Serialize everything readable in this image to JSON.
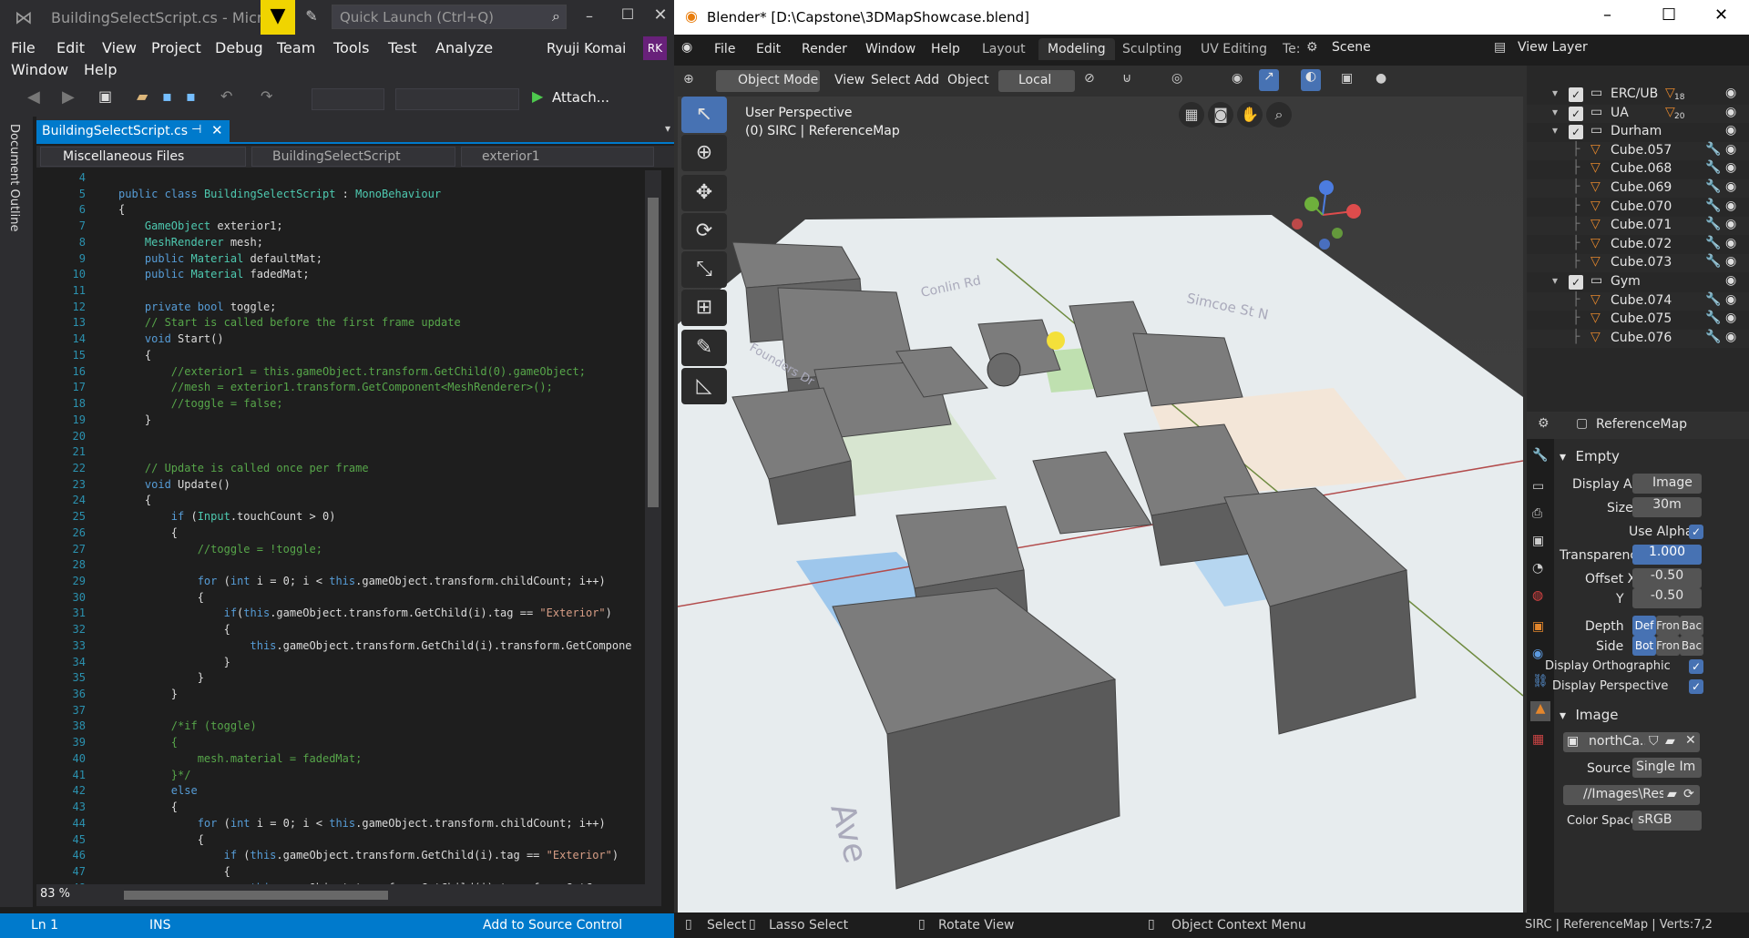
{
  "vs": {
    "title": "BuildingSelectScript.cs - Micros...",
    "quick_launch": "Quick Launch (Ctrl+Q)",
    "menu": [
      "File",
      "Edit",
      "View",
      "Project",
      "Debug",
      "Team",
      "Tools",
      "Test",
      "Analyze",
      "Window",
      "Help"
    ],
    "user": "Ryuji Komai",
    "user_initials": "RK",
    "attach": "Attach...",
    "doc_outline": "Document Outline",
    "tab": "BuildingSelectScript.cs",
    "nav": {
      "project": "Miscellaneous Files",
      "class": "BuildingSelectScript",
      "member": "exterior1"
    },
    "zoom": "83 %",
    "status": {
      "ln": "Ln 1",
      "ins": "INS",
      "source": "Add to Source Control"
    },
    "code": [
      {
        "n": "4",
        "h": ""
      },
      {
        "n": "5",
        "h": "<span class='kw'>public class</span> <span class='ty'>BuildingSelectScript</span> : <span class='ty'>MonoBehaviour</span>"
      },
      {
        "n": "6",
        "h": "{"
      },
      {
        "n": "7",
        "h": "    <span class='ty'>GameObject</span> exterior1;"
      },
      {
        "n": "8",
        "h": "    <span class='ty'>MeshRenderer</span> mesh;"
      },
      {
        "n": "9",
        "h": "    <span class='kw'>public</span> <span class='ty'>Material</span> defaultMat;"
      },
      {
        "n": "10",
        "h": "    <span class='kw'>public</span> <span class='ty'>Material</span> fadedMat;"
      },
      {
        "n": "11",
        "h": ""
      },
      {
        "n": "12",
        "h": "    <span class='kw'>private bool</span> toggle;"
      },
      {
        "n": "13",
        "h": "    <span class='cm'>// Start is called before the first frame update</span>"
      },
      {
        "n": "14",
        "h": "    <span class='kw'>void</span> Start()"
      },
      {
        "n": "15",
        "h": "    {"
      },
      {
        "n": "16",
        "h": "        <span class='cm'>//exterior1 = this.gameObject.transform.GetChild(0).gameObject;</span>"
      },
      {
        "n": "17",
        "h": "        <span class='cm'>//mesh = exterior1.transform.GetComponent&lt;MeshRenderer&gt;();</span>"
      },
      {
        "n": "18",
        "h": "        <span class='cm'>//toggle = false;</span>"
      },
      {
        "n": "19",
        "h": "    }"
      },
      {
        "n": "20",
        "h": ""
      },
      {
        "n": "21",
        "h": ""
      },
      {
        "n": "22",
        "h": "    <span class='cm'>// Update is called once per frame</span>"
      },
      {
        "n": "23",
        "h": "    <span class='kw'>void</span> Update()"
      },
      {
        "n": "24",
        "h": "    {"
      },
      {
        "n": "25",
        "h": "        <span class='kw'>if</span> (<span class='ty'>Input</span>.touchCount &gt; 0)"
      },
      {
        "n": "26",
        "h": "        {"
      },
      {
        "n": "27",
        "h": "            <span class='cm'>//toggle = !toggle;</span>"
      },
      {
        "n": "28",
        "h": ""
      },
      {
        "n": "29",
        "h": "            <span class='kw'>for</span> (<span class='kw'>int</span> i = 0; i &lt; <span class='kw'>this</span>.gameObject.transform.childCount; i++)"
      },
      {
        "n": "30",
        "h": "            {"
      },
      {
        "n": "31",
        "h": "                <span class='kw'>if</span>(<span class='kw'>this</span>.gameObject.transform.GetChild(i).tag == <span class='st'>\"Exterior\"</span>)"
      },
      {
        "n": "32",
        "h": "                {"
      },
      {
        "n": "33",
        "h": "                    <span class='kw'>this</span>.gameObject.transform.GetChild(i).transform.GetCompone"
      },
      {
        "n": "34",
        "h": "                }"
      },
      {
        "n": "35",
        "h": "            }"
      },
      {
        "n": "36",
        "h": "        }"
      },
      {
        "n": "37",
        "h": ""
      },
      {
        "n": "38",
        "h": "        <span class='cm'>/*if (toggle)</span>"
      },
      {
        "n": "39",
        "h": "        <span class='cm'>{</span>"
      },
      {
        "n": "40",
        "h": "            <span class='cm'>mesh.material = fadedMat;</span>"
      },
      {
        "n": "41",
        "h": "        <span class='cm'>}*/</span>"
      },
      {
        "n": "42",
        "h": "        <span class='kw'>else</span>"
      },
      {
        "n": "43",
        "h": "        {"
      },
      {
        "n": "44",
        "h": "            <span class='kw'>for</span> (<span class='kw'>int</span> i = 0; i &lt; <span class='kw'>this</span>.gameObject.transform.childCount; i++)"
      },
      {
        "n": "45",
        "h": "            {"
      },
      {
        "n": "46",
        "h": "                <span class='kw'>if</span> (<span class='kw'>this</span>.gameObject.transform.GetChild(i).tag == <span class='st'>\"Exterior\"</span>)"
      },
      {
        "n": "47",
        "h": "                {"
      },
      {
        "n": "48",
        "h": "                    <span class='kw'>this</span>.gameObject.transform.GetChild(i).transform.GetCompone"
      }
    ]
  },
  "blender": {
    "title": "Blender* [D:\\Capstone\\3DMapShowcase.blend]",
    "menu": [
      "File",
      "Edit",
      "Render",
      "Window",
      "Help"
    ],
    "workspaces": [
      "Layout",
      "Modeling",
      "Sculpting",
      "UV Editing",
      "Te:"
    ],
    "active_workspace": "Modeling",
    "scene": "Scene",
    "view_layer": "View Layer",
    "header": {
      "mode": "Object Mode",
      "view": "View",
      "select": "Select",
      "add": "Add",
      "object": "Object",
      "orientation": "Local"
    },
    "overlay": {
      "line1": "User Perspective",
      "line2": "(0) SIRC | ReferenceMap"
    },
    "map_labels": [
      "Conlin Rd",
      "Founders Dr",
      "Simcoe St N",
      "Ave"
    ],
    "outliner": [
      {
        "name": "ERC/UB",
        "badge": "18",
        "level": 0,
        "collection": true
      },
      {
        "name": "UA",
        "badge": "20",
        "level": 0,
        "collection": true
      },
      {
        "name": "Durham",
        "badge": "",
        "level": 0,
        "collection": true
      },
      {
        "name": "Cube.057",
        "level": 1
      },
      {
        "name": "Cube.068",
        "level": 1
      },
      {
        "name": "Cube.069",
        "level": 1
      },
      {
        "name": "Cube.070",
        "level": 1
      },
      {
        "name": "Cube.071",
        "level": 1
      },
      {
        "name": "Cube.072",
        "level": 1
      },
      {
        "name": "Cube.073",
        "level": 1
      },
      {
        "name": "Gym",
        "badge": "",
        "level": 0,
        "collection": true
      },
      {
        "name": "Cube.074",
        "level": 1
      },
      {
        "name": "Cube.075",
        "level": 1
      },
      {
        "name": "Cube.076",
        "level": 1
      }
    ],
    "props": {
      "object": "ReferenceMap",
      "empty": "Empty",
      "display_as_label": "Display As",
      "display_as": "Image",
      "size_label": "Size",
      "size": "30m",
      "use_alpha": "Use Alpha",
      "transparency_label": "Transparenc",
      "transparency": "1.000",
      "offset_x_label": "Offset X",
      "offset_x": "-0.50",
      "offset_y_label": "Y",
      "offset_y": "-0.50",
      "depth_label": "Depth",
      "depth": [
        "Def",
        "Fron",
        "Bac"
      ],
      "side_label": "Side",
      "side": [
        "Bot",
        "Fron",
        "Bac"
      ],
      "disp_ortho": "Display Orthographic",
      "disp_persp": "Display Perspective",
      "image_panel": "Image",
      "image_name": "northCa..",
      "source_label": "Source",
      "source": "Single Im...",
      "path": "//Images\\Reso...",
      "color_space_label": "Color Space",
      "color_space": "sRGB"
    },
    "status": {
      "select": "Select",
      "lasso": "Lasso Select",
      "rotate": "Rotate View",
      "context": "Object Context Menu",
      "info": "SIRC | ReferenceMap | Verts:7,2"
    }
  }
}
